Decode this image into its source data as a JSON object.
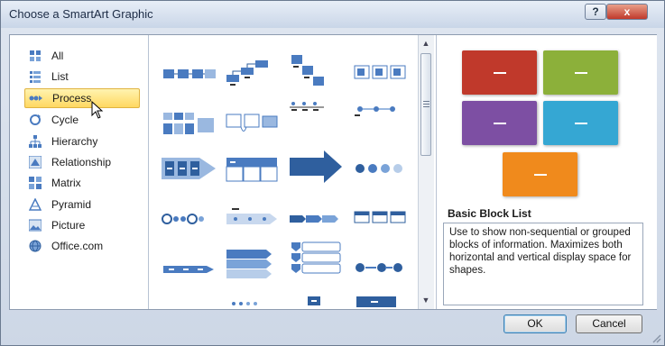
{
  "window": {
    "title": "Choose a SmartArt Graphic",
    "help": "?",
    "close": "x"
  },
  "categories": [
    {
      "label": "All",
      "icon": "all-icon"
    },
    {
      "label": "List",
      "icon": "list-icon"
    },
    {
      "label": "Process",
      "icon": "process-icon",
      "selected": true
    },
    {
      "label": "Cycle",
      "icon": "cycle-icon"
    },
    {
      "label": "Hierarchy",
      "icon": "hierarchy-icon"
    },
    {
      "label": "Relationship",
      "icon": "relationship-icon"
    },
    {
      "label": "Matrix",
      "icon": "matrix-icon"
    },
    {
      "label": "Pyramid",
      "icon": "pyramid-icon"
    },
    {
      "label": "Picture",
      "icon": "picture-icon"
    },
    {
      "label": "Office.com",
      "icon": "globe-icon"
    }
  ],
  "preview": {
    "title": "Basic Block List",
    "description": "Use to show non-sequential or grouped blocks of information. Maximizes both horizontal and vertical display space for shapes.",
    "block_colors": [
      "#c0392b",
      "#8cb03a",
      "#7d4fa3",
      "#35a7d3",
      "#f08a1c"
    ]
  },
  "buttons": {
    "ok": "OK",
    "cancel": "Cancel"
  },
  "colors": {
    "accent": "#2e6db4",
    "selection": "#ffd861"
  }
}
